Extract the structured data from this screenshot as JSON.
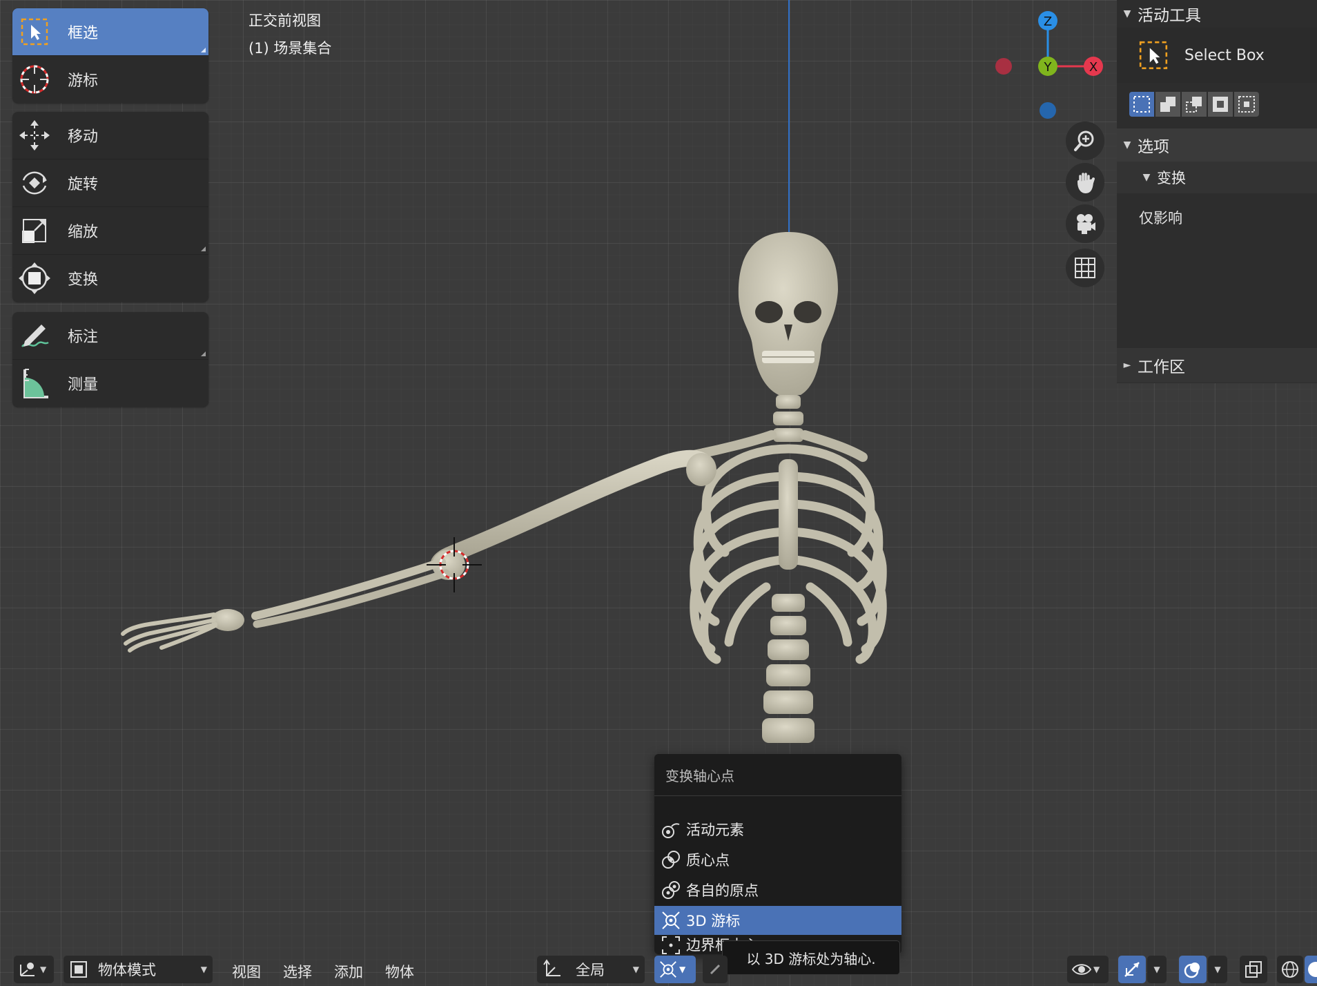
{
  "viewport": {
    "view_name": "正交前视图",
    "collection": "(1) 场景集合"
  },
  "toolbar": {
    "group1": [
      {
        "label": "框选",
        "icon": "select-box-icon",
        "active": true
      },
      {
        "label": "游标",
        "icon": "cursor-icon",
        "active": false
      }
    ],
    "group2": [
      {
        "label": "移动",
        "icon": "move-icon"
      },
      {
        "label": "旋转",
        "icon": "rotate-icon"
      },
      {
        "label": "缩放",
        "icon": "scale-icon"
      },
      {
        "label": "变换",
        "icon": "transform-icon"
      }
    ],
    "group3": [
      {
        "label": "标注",
        "icon": "annotate-icon"
      },
      {
        "label": "测量",
        "icon": "measure-icon"
      }
    ]
  },
  "gizmo": {
    "z": "Z",
    "y": "Y",
    "x": "X"
  },
  "panel": {
    "active_tool_header": "活动工具",
    "active_tool_name": "Select Box",
    "options_header": "选项",
    "transform_header": "变换",
    "affect_only": "仅影响",
    "workspace_header": "工作区"
  },
  "bottom": {
    "mode": "物体模式",
    "menu_view": "视图",
    "menu_select": "选择",
    "menu_add": "添加",
    "menu_object": "物体",
    "orientation": "全局"
  },
  "pivot_popup": {
    "title": "变换轴心点",
    "items": [
      "活动元素",
      "质心点",
      "各自的原点",
      "3D 游标",
      "边界框中心"
    ],
    "selected_index": 3,
    "tooltip": "以 3D 游标处为轴心."
  },
  "colors": {
    "accent": "#5680c2",
    "selected": "#4a72b6",
    "axis_x": "#e5384e",
    "axis_y": "#80b51d",
    "axis_z": "#2a8fe6",
    "bone": "#c9c5b4"
  }
}
